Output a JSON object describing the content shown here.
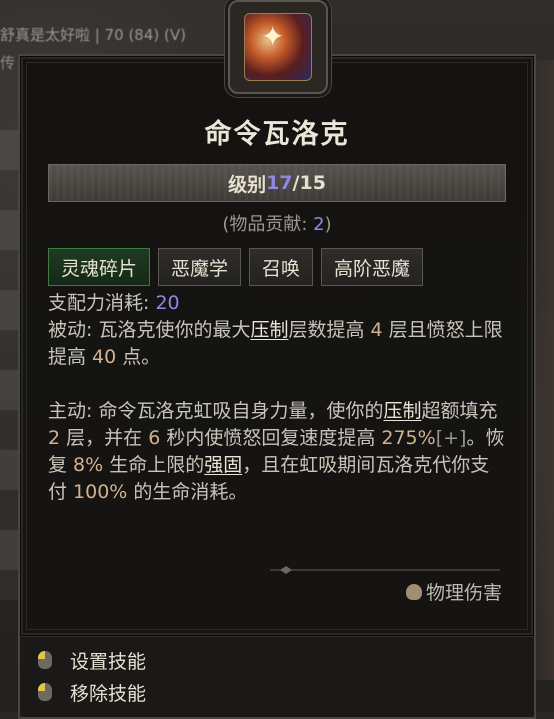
{
  "background": {
    "chat_line_1": "舒真是太好啦 | 70 (84) (V)",
    "chat_line_2": "传"
  },
  "skill": {
    "icon": "summon-skill-icon",
    "title": "命令瓦洛克",
    "rank_label": "级别",
    "rank_current": "17",
    "rank_max": "/15",
    "contrib_prefix": "(物品贡献: ",
    "contrib_value": "2",
    "contrib_suffix": ")",
    "tags": [
      "灵魂碎片",
      "恶魔学",
      "召唤",
      "高阶恶魔"
    ],
    "dominance_label": "支配力消耗: ",
    "dominance_value": "20",
    "passive": {
      "p1": "被动: 瓦洛克使你的最大",
      "u1": "压制",
      "p2": "层数提高 ",
      "n1": "4",
      "p3": " 层且愤怒上限提高 ",
      "n2": "40",
      "p4": " 点。"
    },
    "active": {
      "p1": "主动: 命令瓦洛克虹吸自身力量，使你的",
      "u1": "压制",
      "p2": "超额填充 ",
      "n1": "2",
      "p3": " 层，并在 ",
      "n2": "6",
      "p4": " 秒内使愤怒回复速度提高 ",
      "n3": "275%",
      "n3b": "[+]",
      "p5": "。恢复 ",
      "n4": "8%",
      "p6": " 生命上限的",
      "u2": "强固",
      "p7": "，且在虹吸期间瓦洛克代你支付 ",
      "n5": "100%",
      "p8": " 的生命消耗。"
    },
    "damage_type": "物理伤害"
  },
  "actions": [
    {
      "label": "设置技能",
      "icon": "left-mouse-icon"
    },
    {
      "label": "移除技能",
      "icon": "left-mouse-icon"
    }
  ],
  "colors": {
    "highlight_number": "#8f86e6",
    "active_tag": "#1f3b22"
  }
}
